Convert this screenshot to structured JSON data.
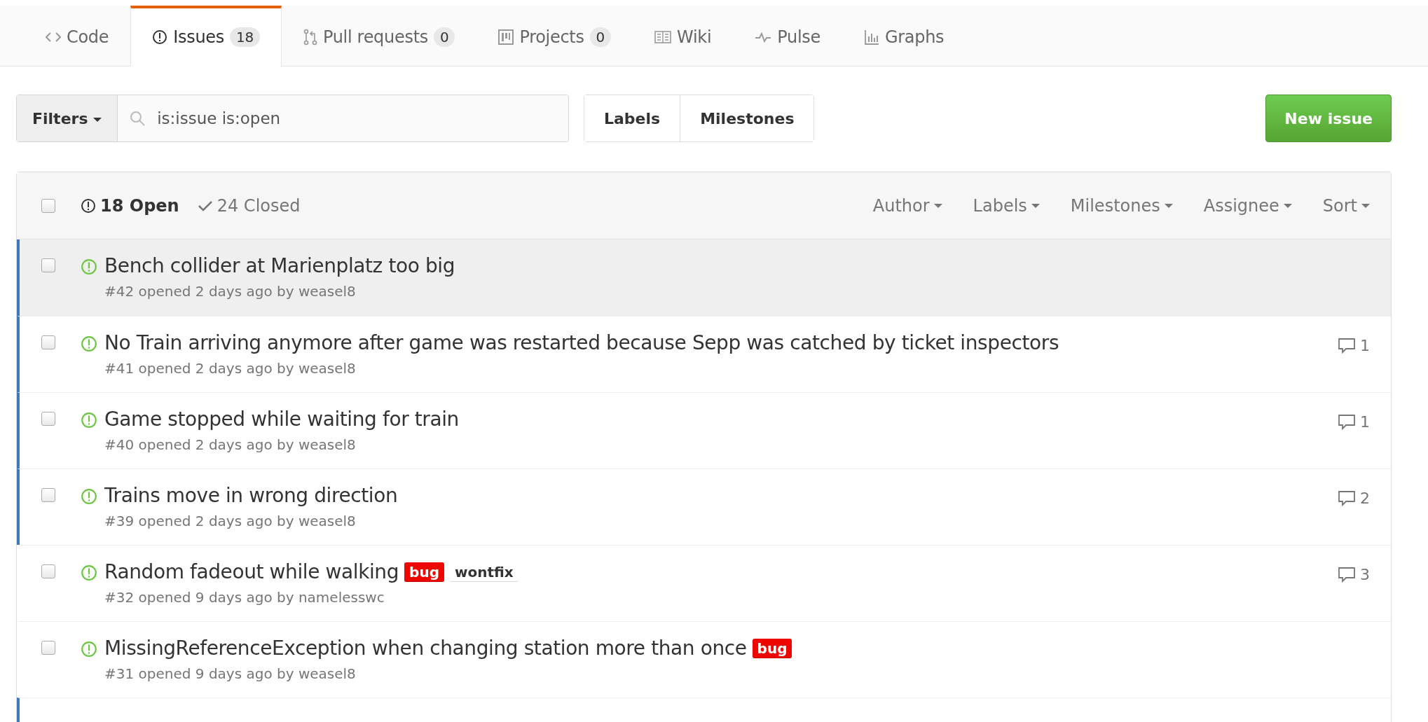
{
  "tabs": [
    {
      "label": "Code",
      "selected": false
    },
    {
      "label": "Issues",
      "count": "18",
      "selected": true
    },
    {
      "label": "Pull requests",
      "count": "0",
      "selected": false
    },
    {
      "label": "Projects",
      "count": "0",
      "selected": false
    },
    {
      "label": "Wiki",
      "selected": false
    },
    {
      "label": "Pulse",
      "selected": false
    },
    {
      "label": "Graphs",
      "selected": false
    }
  ],
  "filters": {
    "button": "Filters",
    "search_value": "is:issue is:open"
  },
  "nav_buttons": [
    "Labels",
    "Milestones"
  ],
  "new_issue_button": "New issue",
  "list_header": {
    "checked": false,
    "open": {
      "label": "18 Open",
      "selected": true
    },
    "closed": {
      "label": "24 Closed",
      "selected": false
    },
    "menus": [
      "Author",
      "Labels",
      "Milestones",
      "Assignee",
      "Sort"
    ]
  },
  "issues": [
    {
      "title": "Bench collider at Marienplatz too big",
      "meta": "#42 opened 2 days ago by weasel8",
      "checked": false,
      "unread": true,
      "hovered": true
    },
    {
      "title": "No Train arriving anymore after game was restarted because Sepp was catched by ticket inspectors",
      "meta": "#41 opened 2 days ago by weasel8",
      "comments": "1",
      "checked": false,
      "unread": true,
      "hovered": false
    },
    {
      "title": "Game stopped while waiting for train",
      "meta": "#40 opened 2 days ago by weasel8",
      "comments": "1",
      "checked": false,
      "unread": true,
      "hovered": false
    },
    {
      "title": "Trains move in wrong direction",
      "meta": "#39 opened 2 days ago by weasel8",
      "comments": "2",
      "checked": false,
      "unread": true,
      "hovered": false
    },
    {
      "title": "Random fadeout while walking",
      "meta": "#32 opened 9 days ago by namelesswc",
      "labels": [
        {
          "name": "bug",
          "color": "#ee0701"
        },
        {
          "name": "wontfix",
          "color": "#ffffff"
        }
      ],
      "comments": "3",
      "checked": false,
      "unread": false,
      "hovered": false
    },
    {
      "title": "MissingReferenceException when changing station more than once",
      "meta": "#31 opened 9 days ago by weasel8",
      "labels": [
        {
          "name": "bug",
          "color": "#ee0701"
        }
      ],
      "checked": false,
      "unread": false,
      "hovered": false
    },
    {
      "unread": true
    }
  ]
}
